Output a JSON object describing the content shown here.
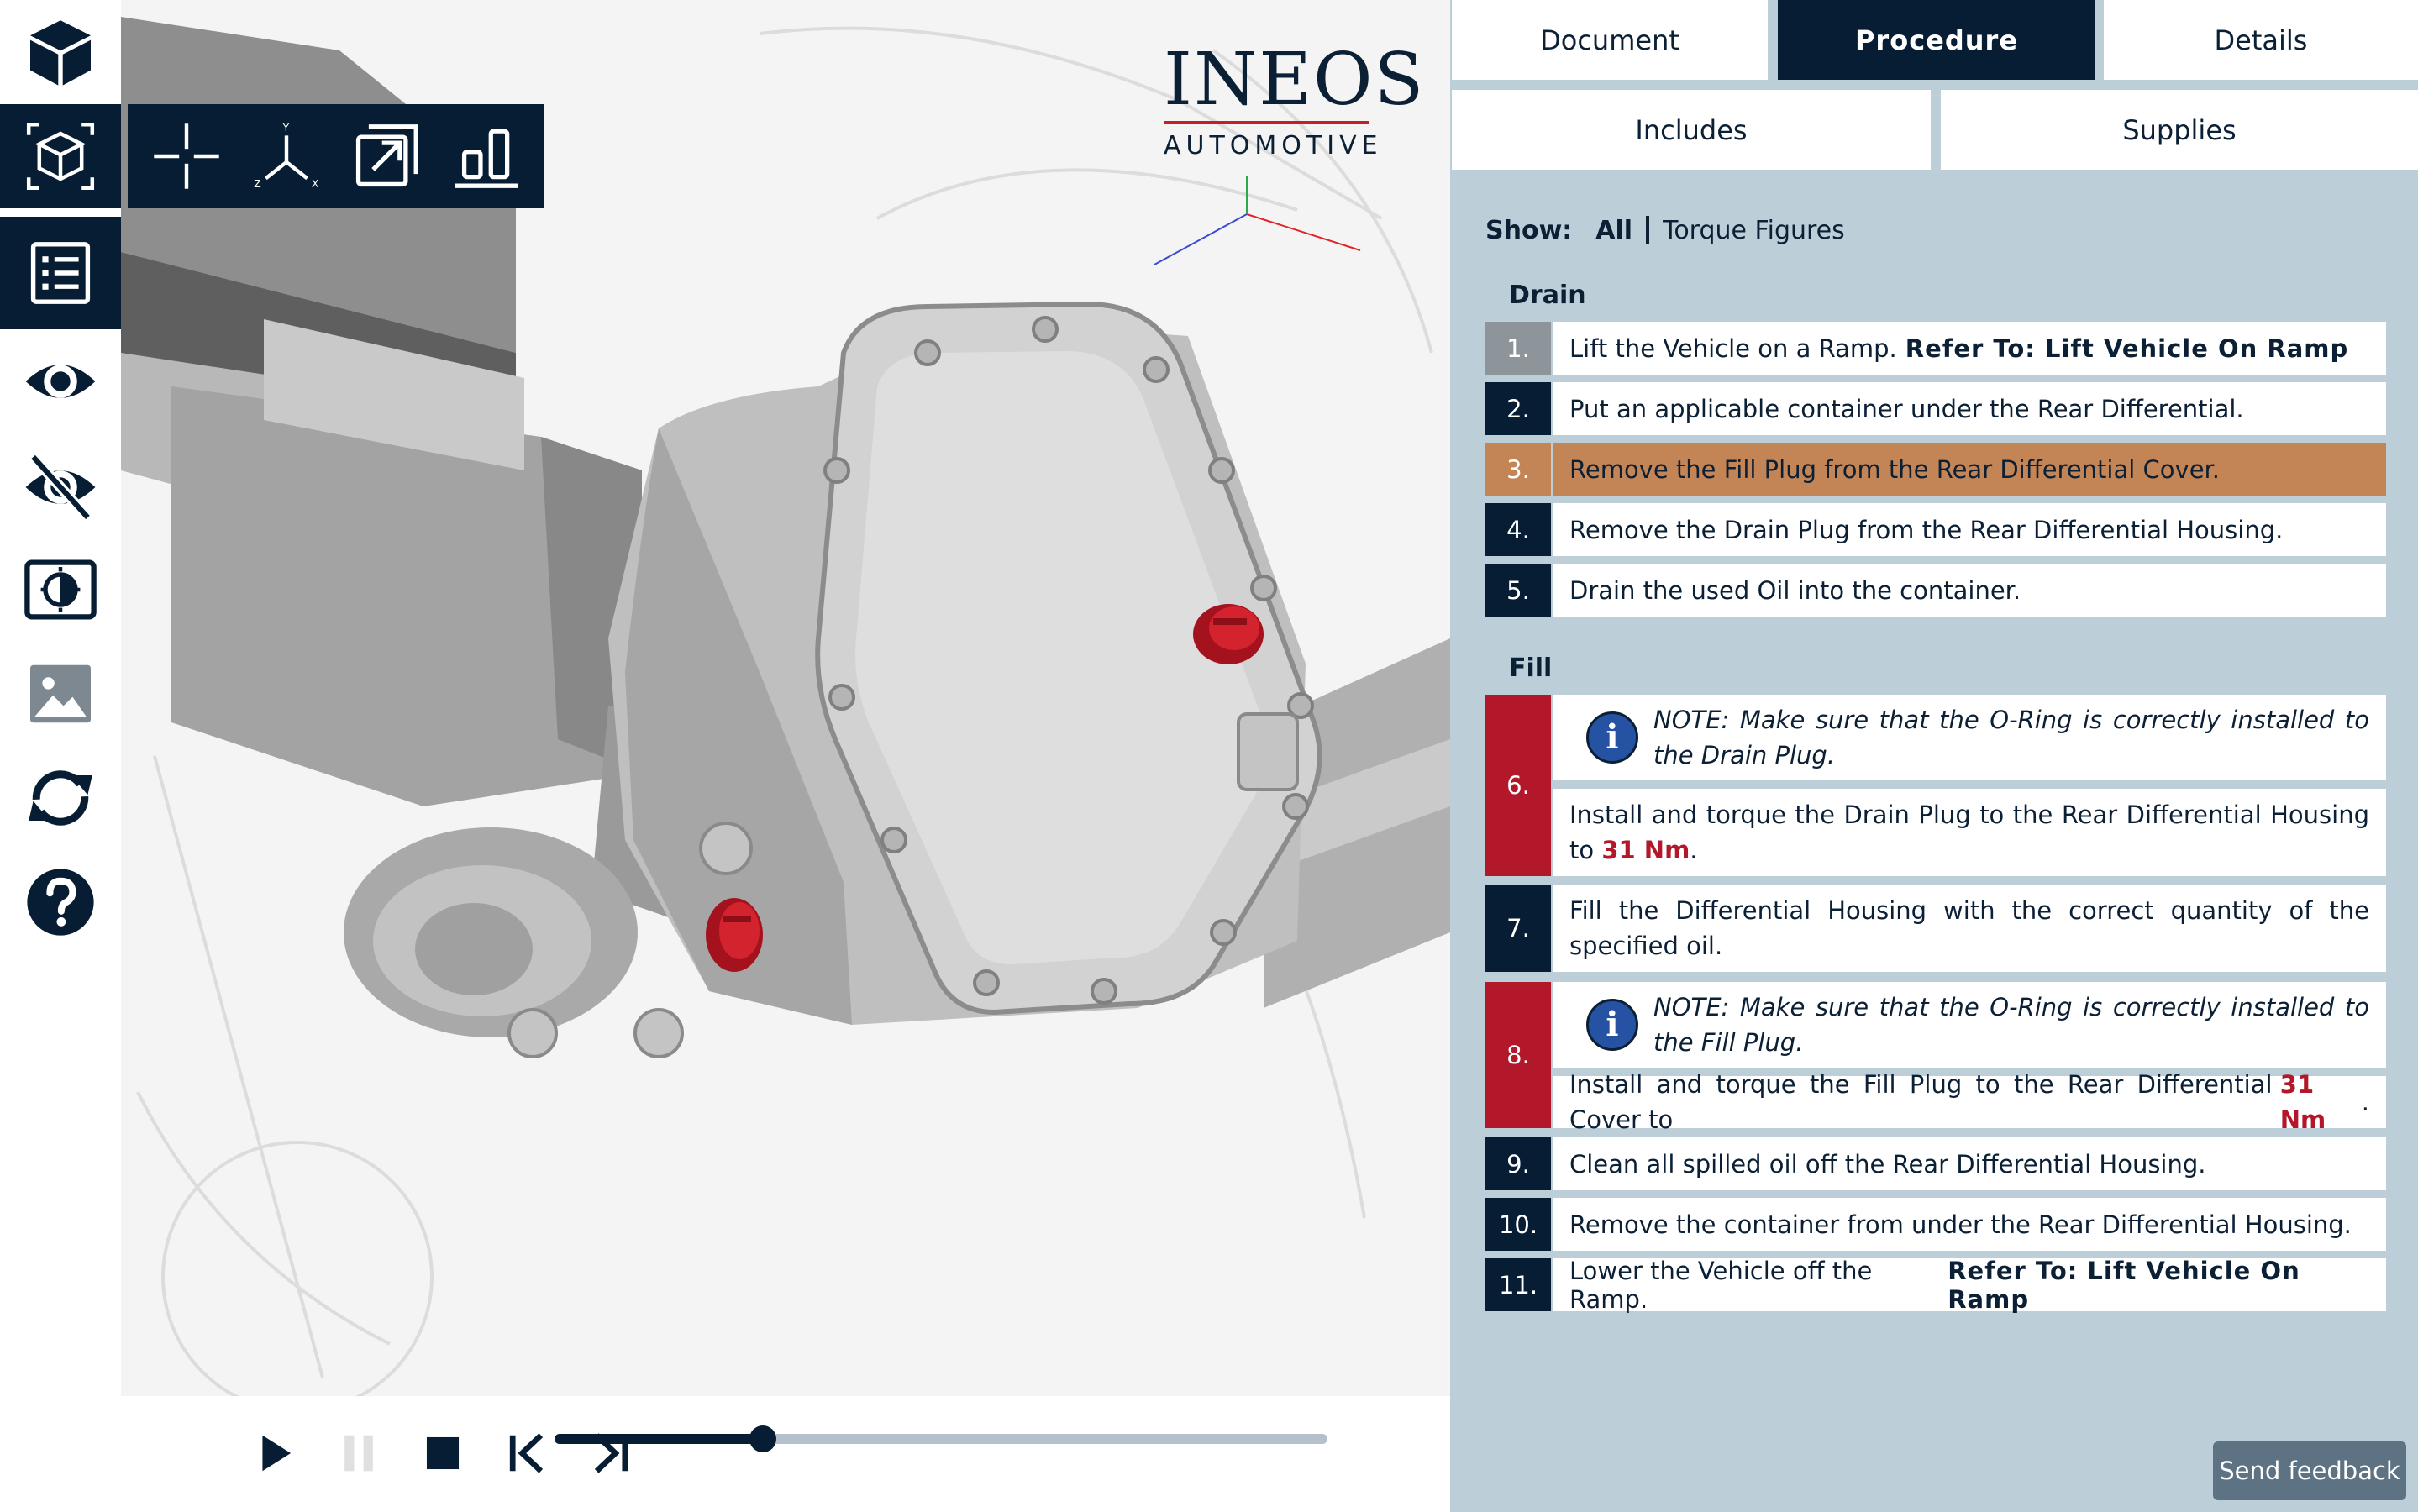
{
  "sidebar": {
    "items": [
      {
        "icon": "cube-icon"
      },
      {
        "icon": "cube-outline-icon"
      },
      {
        "icon": "list-icon"
      },
      {
        "icon": "eye-icon"
      },
      {
        "icon": "eye-off-icon"
      },
      {
        "icon": "contrast-icon"
      },
      {
        "icon": "image-icon"
      },
      {
        "icon": "sync-icon"
      },
      {
        "icon": "help-icon"
      }
    ]
  },
  "toolbar": {
    "tools": [
      {
        "icon": "crosshair-icon"
      },
      {
        "icon": "axes-icon",
        "axis_labels": {
          "y": "Y",
          "z": "Z",
          "x": "X"
        }
      },
      {
        "icon": "expand-icon"
      },
      {
        "icon": "bar-chart-icon"
      }
    ]
  },
  "logo": {
    "brand": "INEOS",
    "sub": "AUTOMOTIVE"
  },
  "tabs": {
    "document": "Document",
    "procedure": "Procedure",
    "details": "Details",
    "includes": "Includes",
    "supplies": "Supplies"
  },
  "filter": {
    "label": "Show:",
    "all": "All",
    "torque": "Torque Figures"
  },
  "sections": {
    "drain": "Drain",
    "fill": "Fill"
  },
  "steps": [
    {
      "num": "1.",
      "text": "Lift the Vehicle on a Ramp.",
      "ref": "Refer To: Lift Vehicle On Ramp"
    },
    {
      "num": "2.",
      "text": "Put an applicable container under the Rear Differential."
    },
    {
      "num": "3.",
      "text": "Remove the Fill Plug from the Rear Differential Cover."
    },
    {
      "num": "4.",
      "text": "Remove the Drain Plug from the Rear Differential Housing."
    },
    {
      "num": "5.",
      "text": "Drain the used Oil into the container."
    },
    {
      "num": "6.",
      "note": "NOTE: Make sure that the O-Ring is correctly installed to the Drain Plug.",
      "text": "Install and torque the Drain Plug to the Rear Differential Housing to",
      "torque": "31 Nm",
      "end": "."
    },
    {
      "num": "7.",
      "text": "Fill the Differential Housing with the correct quantity of the specified oil."
    },
    {
      "num": "8.",
      "note": "NOTE: Make sure that the O-Ring is correctly installed to the Fill Plug.",
      "text": "Install and torque the Fill Plug to the Rear Differential Cover to",
      "torque": "31 Nm",
      "end": "."
    },
    {
      "num": "9.",
      "text": "Clean all spilled oil off the Rear Differential Housing."
    },
    {
      "num": "10.",
      "text": "Remove the container from under the Rear Differential Housing."
    },
    {
      "num": "11.",
      "text": "Lower the Vehicle off the Ramp.",
      "ref": "Refer To: Lift Vehicle On Ramp"
    }
  ],
  "playback": {
    "progress": 0.27
  },
  "feedback": {
    "label": "Send feedback"
  },
  "colors": {
    "navy": "#071d33",
    "current": "#c48556",
    "warning": "#b3182a",
    "panel": "#bccfd9",
    "done": "#8d959b"
  }
}
